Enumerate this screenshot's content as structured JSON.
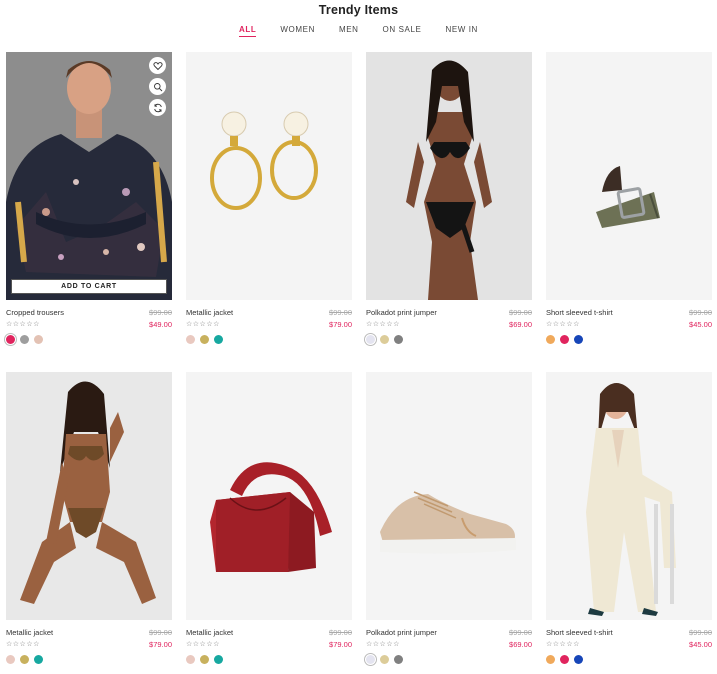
{
  "section": {
    "title": "Trendy Items"
  },
  "tabs": [
    {
      "label": "ALL",
      "active": true
    },
    {
      "label": "WOMEN"
    },
    {
      "label": "MEN"
    },
    {
      "label": "ON SALE"
    },
    {
      "label": "NEW IN"
    }
  ],
  "quick_actions": {
    "add_to_cart_label": "ADD TO CART"
  },
  "products": [
    {
      "name": "Cropped trousers",
      "old_price": "$99.00",
      "price": "$49.00",
      "rating": "☆☆☆☆☆",
      "swatches": [
        "#e0245e",
        "#9e9e9e",
        "#e3c2b4"
      ]
    },
    {
      "name": "Metallic jacket",
      "old_price": "$99.00",
      "price": "$79.00",
      "rating": "☆☆☆☆☆",
      "swatches": [
        "#e9c9c0",
        "#c8b15e",
        "#17a8a0"
      ]
    },
    {
      "name": "Polkadot print jumper",
      "old_price": "$99.00",
      "price": "$69.00",
      "rating": "☆☆☆☆☆",
      "swatches": [
        "#e4e4f0",
        "#dccc99",
        "#808080"
      ]
    },
    {
      "name": "Short sleeved t-shirt",
      "old_price": "$99.00",
      "price": "$45.00",
      "rating": "☆☆☆☆☆",
      "swatches": [
        "#f0a95b",
        "#e0245e",
        "#1746b8"
      ]
    },
    {
      "name": "Metallic jacket",
      "old_price": "$99.00",
      "price": "$79.00",
      "rating": "☆☆☆☆☆",
      "swatches": [
        "#e9c9c0",
        "#c8b15e",
        "#17a8a0"
      ]
    },
    {
      "name": "Metallic jacket",
      "old_price": "$99.00",
      "price": "$79.00",
      "rating": "☆☆☆☆☆",
      "swatches": [
        "#e9c9c0",
        "#c8b15e",
        "#17a8a0"
      ]
    },
    {
      "name": "Polkadot print jumper",
      "old_price": "$99.00",
      "price": "$69.00",
      "rating": "☆☆☆☆☆",
      "swatches": [
        "#e4e4f0",
        "#dccc99",
        "#808080"
      ]
    },
    {
      "name": "Short sleeved t-shirt",
      "old_price": "$99.00",
      "price": "$45.00",
      "rating": "☆☆☆☆☆",
      "swatches": [
        "#f0a95b",
        "#e0245e",
        "#1746b8"
      ]
    }
  ],
  "images": [
    "man-floral-bomber-jacket",
    "gold-pearl-hoop-earrings",
    "woman-black-swimsuit",
    "olive-canvas-belt",
    "woman-brown-bikini",
    "red-leather-tote-bag",
    "beige-knit-sneaker",
    "woman-cream-suit"
  ],
  "colors": {
    "accent": "#e0245e",
    "muted": "#aaaaaa"
  }
}
